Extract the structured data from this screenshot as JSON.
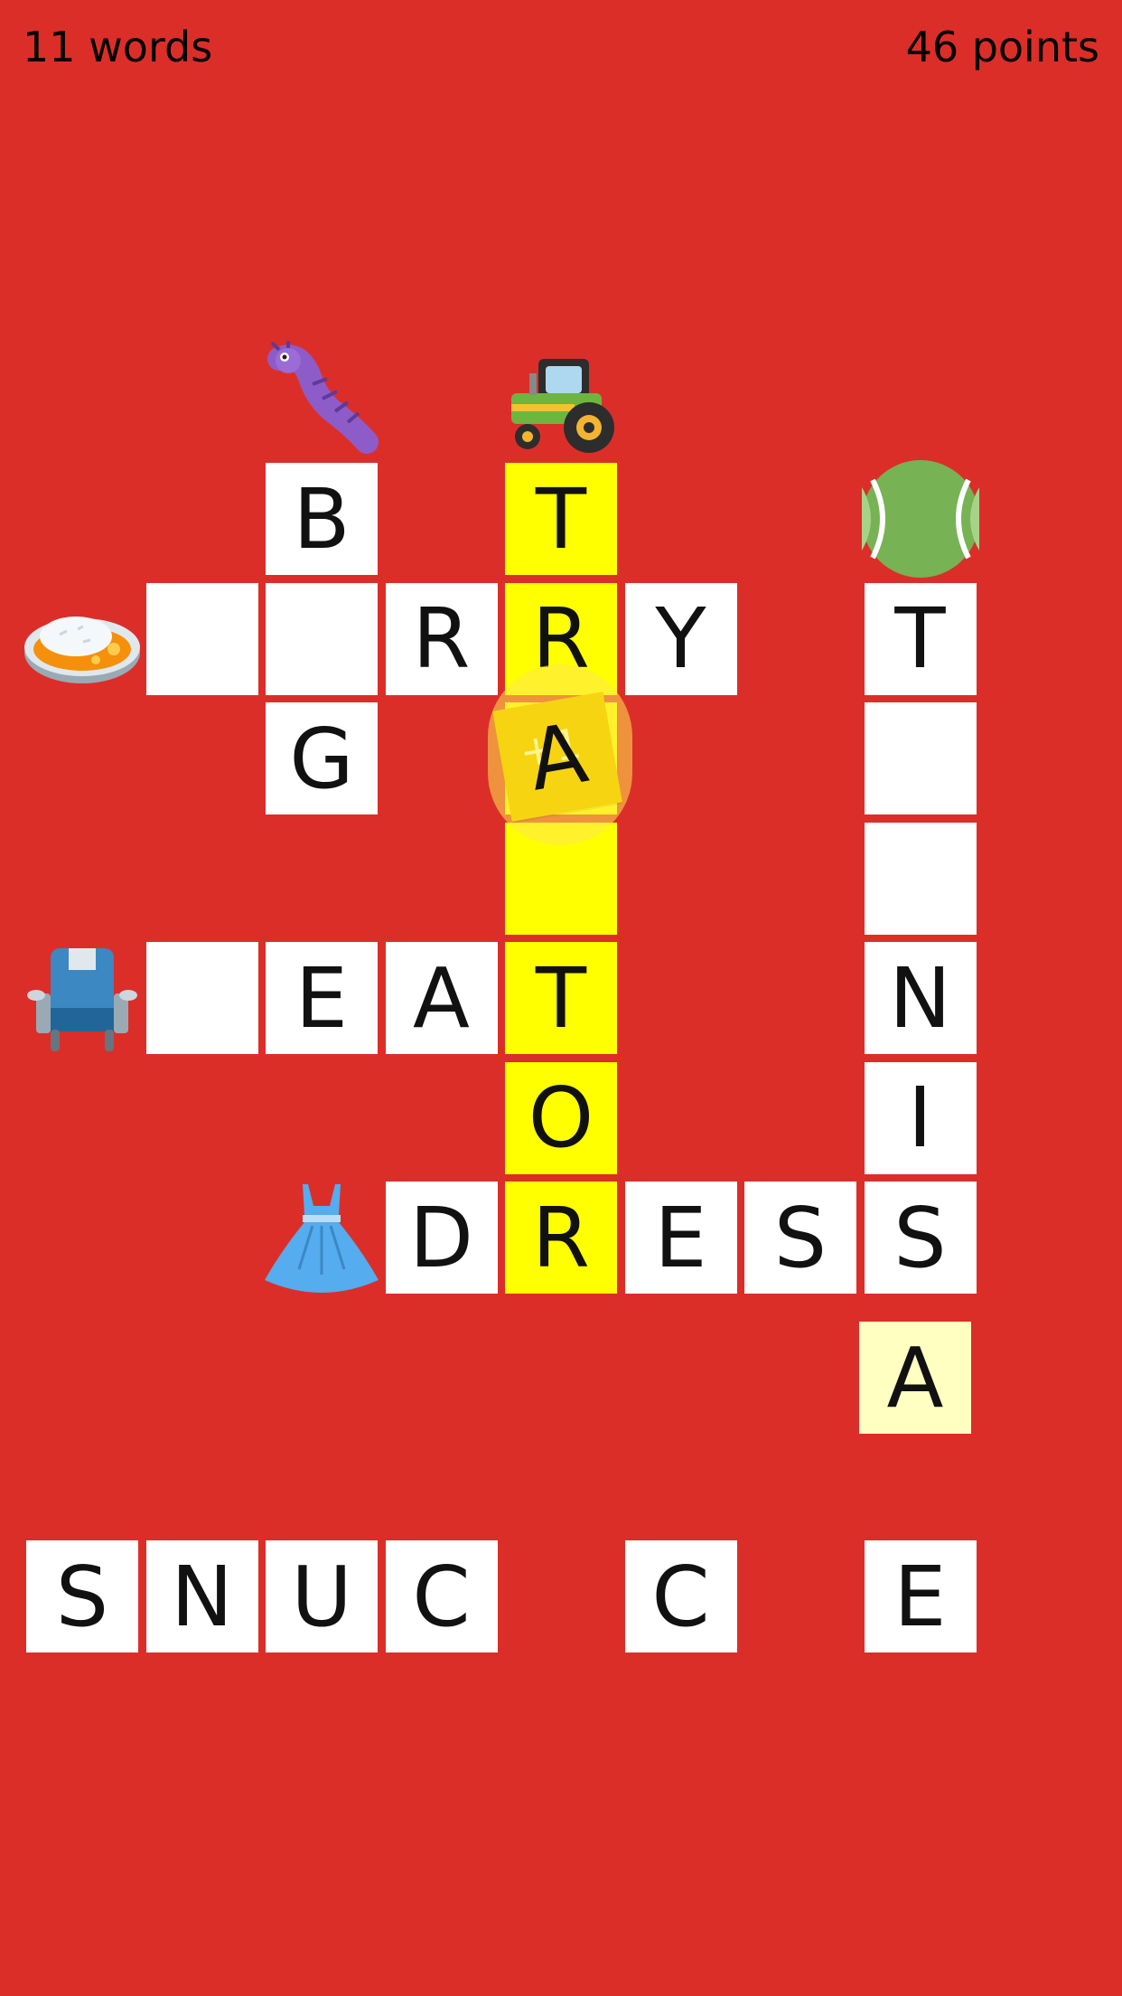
{
  "hud": {
    "words": "11 words",
    "points": "46 points"
  },
  "colors": {
    "background": "#DC2E29",
    "cell_white": "#FFFFFF",
    "cell_highlight": "#FFFF00",
    "cell_pale": "#FFFFC2",
    "drag_tile": "#F7D412"
  },
  "board": {
    "cells": [
      {
        "row": 0,
        "col": 2,
        "letter": "B",
        "style": "white"
      },
      {
        "row": 0,
        "col": 4,
        "letter": "T",
        "style": "yellow"
      },
      {
        "row": 1,
        "col": 1,
        "letter": "",
        "style": "white"
      },
      {
        "row": 1,
        "col": 2,
        "letter": "",
        "style": "white"
      },
      {
        "row": 1,
        "col": 3,
        "letter": "R",
        "style": "white"
      },
      {
        "row": 1,
        "col": 4,
        "letter": "R",
        "style": "yellow"
      },
      {
        "row": 1,
        "col": 5,
        "letter": "Y",
        "style": "white"
      },
      {
        "row": 1,
        "col": 7,
        "letter": "T",
        "style": "white"
      },
      {
        "row": 2,
        "col": 2,
        "letter": "G",
        "style": "white"
      },
      {
        "row": 2,
        "col": 4,
        "letter": "",
        "style": "yellow"
      },
      {
        "row": 2,
        "col": 7,
        "letter": "",
        "style": "white"
      },
      {
        "row": 3,
        "col": 4,
        "letter": "",
        "style": "yellow"
      },
      {
        "row": 3,
        "col": 7,
        "letter": "",
        "style": "white"
      },
      {
        "row": 4,
        "col": 1,
        "letter": "",
        "style": "white"
      },
      {
        "row": 4,
        "col": 2,
        "letter": "E",
        "style": "white"
      },
      {
        "row": 4,
        "col": 3,
        "letter": "A",
        "style": "white"
      },
      {
        "row": 4,
        "col": 4,
        "letter": "T",
        "style": "yellow"
      },
      {
        "row": 4,
        "col": 7,
        "letter": "N",
        "style": "white"
      },
      {
        "row": 5,
        "col": 4,
        "letter": "O",
        "style": "yellow"
      },
      {
        "row": 5,
        "col": 7,
        "letter": "I",
        "style": "white"
      },
      {
        "row": 6,
        "col": 3,
        "letter": "D",
        "style": "white"
      },
      {
        "row": 6,
        "col": 4,
        "letter": "R",
        "style": "yellow"
      },
      {
        "row": 6,
        "col": 5,
        "letter": "E",
        "style": "white"
      },
      {
        "row": 6,
        "col": 6,
        "letter": "S",
        "style": "white"
      },
      {
        "row": 6,
        "col": 7,
        "letter": "S",
        "style": "white"
      }
    ],
    "clues": [
      {
        "icon": "caterpillar-icon",
        "row": -1,
        "col": 2
      },
      {
        "icon": "tractor-icon",
        "row": -1,
        "col": 4
      },
      {
        "icon": "tennis-ball-icon",
        "row": 0,
        "col": 7
      },
      {
        "icon": "rice-plate-icon",
        "row": 1,
        "col": 0
      },
      {
        "icon": "seat-icon",
        "row": 4,
        "col": 0
      },
      {
        "icon": "dress-icon",
        "row": 6,
        "col": 2
      }
    ]
  },
  "dragged_tile": {
    "letter": "A",
    "bonus": "+1"
  },
  "placed_tile": {
    "letter": "A"
  },
  "tray": [
    {
      "slot": 0,
      "letter": "S"
    },
    {
      "slot": 1,
      "letter": "N"
    },
    {
      "slot": 2,
      "letter": "U"
    },
    {
      "slot": 3,
      "letter": "C"
    },
    {
      "slot": 5,
      "letter": "C"
    },
    {
      "slot": 7,
      "letter": "E"
    }
  ]
}
